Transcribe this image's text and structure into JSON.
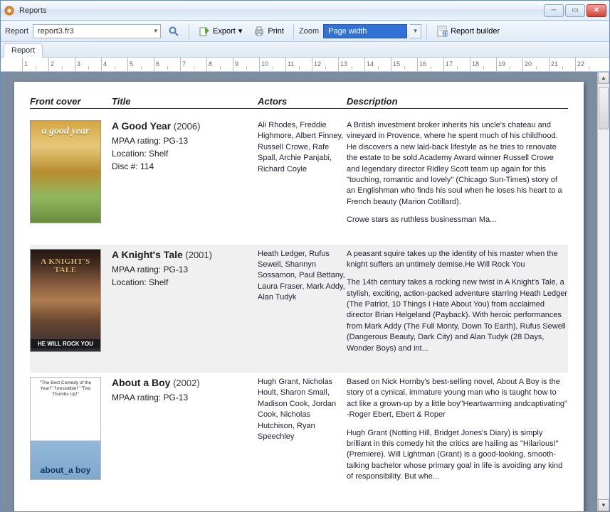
{
  "window": {
    "title": "Reports"
  },
  "toolbar": {
    "report_label": "Report",
    "report_value": "report3.fr3",
    "export_label": "Export",
    "print_label": "Print",
    "zoom_label": "Zoom",
    "zoom_value": "Page width",
    "builder_label": "Report builder"
  },
  "tabs": {
    "active": "Report"
  },
  "ruler_max": 22,
  "headers": {
    "cover": "Front cover",
    "title": "Title",
    "actors": "Actors",
    "desc": "Description"
  },
  "rows": [
    {
      "cover_style": "cov1",
      "cover_text": "a good year",
      "title": "A Good Year",
      "year": "(2006)",
      "rating": "MPAA rating: PG-13",
      "location": "Location: Shelf",
      "disc": "Disc #: 114",
      "actors": "Ali Rhodes, Freddie Highmore, Albert Finney, Russell Crowe, Rafe Spall, Archie Panjabi, Richard Coyle",
      "desc1": "A British investment broker inherits his uncle's chateau and vineyard in Provence, where he spent much of his childhood. He discovers a new laid-back lifestyle as he tries to renovate the estate to be sold.Academy Award winner Russell Crowe and legendary director Ridley Scott team up again for this \"touching, romantic and lovely\" (Chicago Sun-Times) story of an Englishman who finds his soul when he loses his heart to a French beauty (Marion Cotillard).",
      "desc2": "Crowe stars as ruthless businessman Ma..."
    },
    {
      "cover_style": "cov2",
      "cover_text": "A KNIGHT'S TALE",
      "cover_tagline": "HE WILL ROCK YOU",
      "title": "A Knight's Tale",
      "year": "(2001)",
      "rating": "MPAA rating: PG-13",
      "location": "Location: Shelf",
      "disc": "",
      "actors": "Heath Ledger, Rufus Sewell, Shannyn Sossamon, Paul Bettany, Laura Fraser, Mark Addy, Alan Tudyk",
      "desc1": "A peasant squire takes up the identity of his master when the knight suffers an untimely demise.He Will Rock You",
      "desc2": "The 14th century takes a rocking new twist in A Knight's Tale, a stylish, exciting, action-packed adventure starring Heath Ledger (The Patriot, 10 Things I Hate About You) from acclaimed director Brian Helgeland (Payback).  With heroic performances from Mark Addy (The Full Monty, Down To Earth), Rufus Sewell (Dangerous Beauty, Dark City) and Alan Tudyk (28 Days, Wonder Boys) and int..."
    },
    {
      "cover_style": "cov3",
      "cover_quotes": "\"The Best Comedy of the Year!\"\n\"Irresistible!\"\n\"Two Thumbs Up!\"",
      "cover_logo_a": "about",
      "cover_logo_b": "a boy",
      "title": "About a Boy",
      "year": "(2002)",
      "rating": "MPAA rating: PG-13",
      "location": "",
      "disc": "",
      "actors": "Hugh Grant, Nicholas Hoult, Sharon Small, Madison Cook, Jordan Cook, Nicholas Hutchison, Ryan Speechley",
      "desc1": "Based on Nick Hornby's best-selling novel, About A Boy is the story of a cynical, immature young man who is taught how to act like a grown-up by a little boy\"Heartwarming andcaptivating\"  -Roger Ebert, Ebert & Roper",
      "desc2": "Hugh Grant (Notting Hill, Bridget Jones's Diary) is simply brilliant in this comedy hit the critics are hailing as \"Hilarious!\" (Premiere).  Will Lightman (Grant) is a good-looking, smooth-talking bachelor whose primary goal in life is avoiding any kind of responsibility.  But whe..."
    }
  ]
}
